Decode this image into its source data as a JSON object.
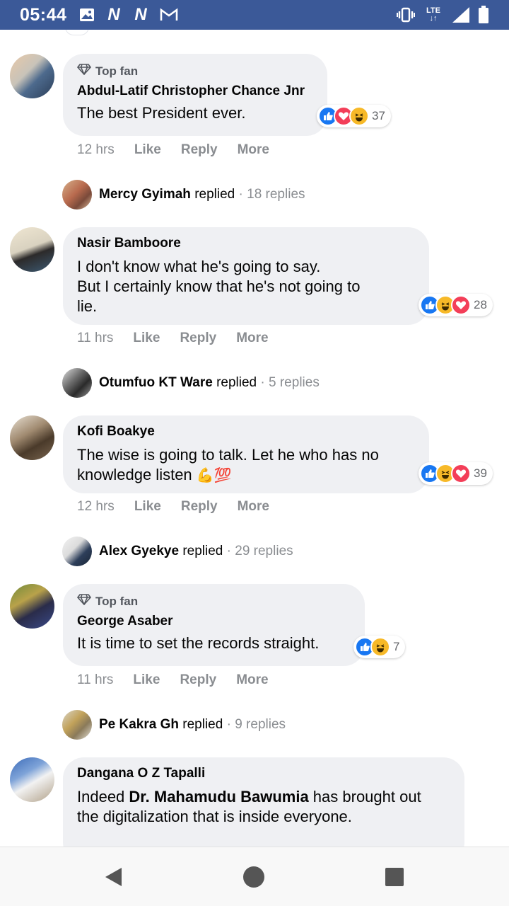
{
  "statusbar": {
    "time": "05:44",
    "network_top": "LTE",
    "icons": [
      "image-icon",
      "n-app-icon",
      "n-app-icon",
      "gmail-icon",
      "vibrate-icon",
      "lte-icon",
      "signal-icon",
      "battery-icon"
    ]
  },
  "comments": [
    {
      "top_fan": true,
      "badge": "Top fan",
      "author": "Abdul-Latif Christopher Chance Jnr",
      "text": "The best President ever.",
      "reactions": [
        "like",
        "love",
        "haha"
      ],
      "reaction_count": "37",
      "time": "12 hrs",
      "like": "Like",
      "reply": "Reply",
      "more": "More",
      "reply_summary": {
        "name": "Mercy Gyimah",
        "verb": "replied",
        "count": "· 18 replies"
      }
    },
    {
      "top_fan": false,
      "author": "Nasir Bamboore",
      "text_line1": "I don't know what he's going to say.",
      "text_line2": "But I certainly know that he's not going to",
      "text_line3": "lie.",
      "reactions": [
        "like",
        "haha",
        "love"
      ],
      "reaction_count": "28",
      "time": "11 hrs",
      "like": "Like",
      "reply": "Reply",
      "more": "More",
      "reply_summary": {
        "name": "Otumfuo KT Ware",
        "verb": "replied",
        "count": "· 5 replies"
      }
    },
    {
      "top_fan": false,
      "author": "Kofi Boakye",
      "text_line1": "The wise is going to talk. Let he who has no",
      "text_line2": "knowledge listen",
      "emoji": "💪💯",
      "reactions": [
        "like",
        "haha",
        "love"
      ],
      "reaction_count": "39",
      "time": "12 hrs",
      "like": "Like",
      "reply": "Reply",
      "more": "More",
      "reply_summary": {
        "name": "Alex Gyekye",
        "verb": "replied",
        "count": "· 29 replies"
      }
    },
    {
      "top_fan": true,
      "badge": "Top fan",
      "author": "George Asaber",
      "text": "It is time to set the records straight.",
      "reactions": [
        "like",
        "haha"
      ],
      "reaction_count": "7",
      "time": "11 hrs",
      "like": "Like",
      "reply": "Reply",
      "more": "More",
      "reply_summary": {
        "name": "Pe Kakra Gh",
        "verb": "replied",
        "count": "· 9 replies"
      }
    },
    {
      "top_fan": false,
      "author": "Dangana O Z Tapalli",
      "text_prefix": "Indeed ",
      "text_bold": "Dr. Mahamudu Bawumia",
      "text_suffix": " has brought out",
      "text_line2": "the digitalization that is inside everyone."
    }
  ],
  "navbar": {
    "buttons": [
      "back-button",
      "home-button",
      "recents-button"
    ]
  },
  "colors": {
    "statusbar": "#3b5998",
    "bubble": "#eff0f3",
    "like": "#1877f2",
    "love": "#f33e58",
    "haha": "#f7b928",
    "meta": "#8a8d91"
  }
}
